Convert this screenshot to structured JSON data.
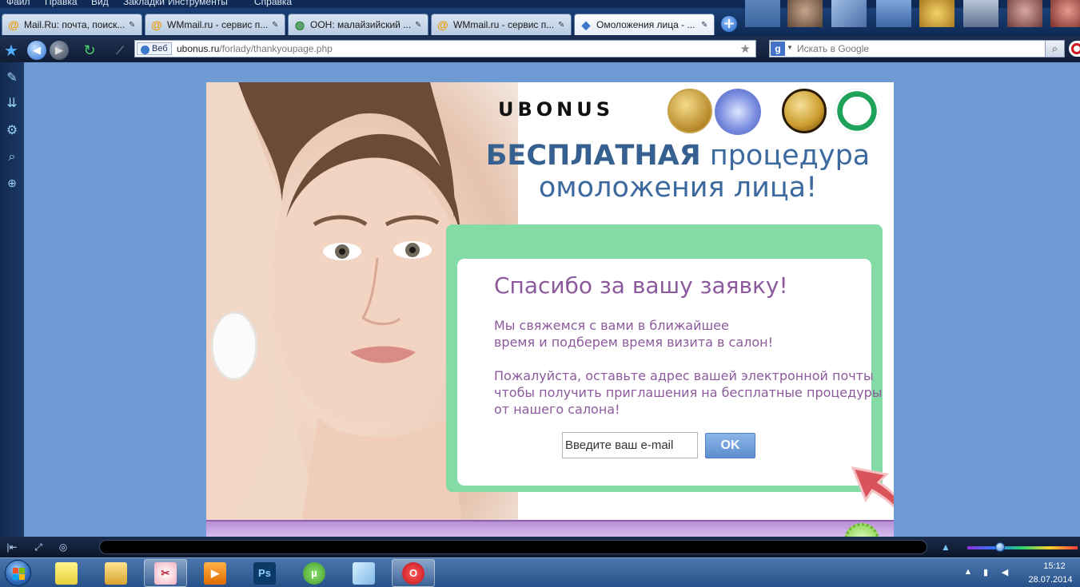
{
  "menu": [
    "Файл",
    "Правка",
    "Вид",
    "Закладки",
    "Инструменты",
    "Справка"
  ],
  "tabs": [
    {
      "label": "Mail.Ru: почта, поиск...",
      "icon": "mailru-icon"
    },
    {
      "label": "WMmail.ru - сервис п...",
      "icon": "at-sign-icon"
    },
    {
      "label": "ООН: малайзийский ...",
      "icon": "globe-icon"
    },
    {
      "label": "WMmail.ru - сервис п...",
      "icon": "at-sign-icon"
    },
    {
      "label": "Омоложения лица - ...",
      "icon": "page-icon"
    }
  ],
  "address": {
    "type_label": "Веб",
    "url_host": "ubonus.ru",
    "url_path": "/forlady/thankyoupage.php"
  },
  "search": {
    "engine": "g",
    "placeholder": "Искать в Google"
  },
  "page": {
    "brand": "Ubonus",
    "headline_strong": "БЕСПЛАТНАЯ",
    "headline_rest_1": "процедура",
    "headline_rest_2": "омоложения лица!",
    "thanks_title": "Спасибо за вашу заявку!",
    "message_lines": [
      "Мы свяжемся с вами в ближайшее",
      "время и подберем время визита в салон!",
      "Пожалуйста, оставьте адрес вашей электронной почты",
      "чтобы получить приглашения на бесплатные процедуры",
      "от нашего салона!"
    ],
    "email_placeholder": "Введите ваш e-mail",
    "ok_label": "OK",
    "badges": [
      "gold-award-badge",
      "quality-guarantee-badge",
      "100-percent-badge",
      "green-seal-badge"
    ]
  },
  "clock": {
    "time": "15:12",
    "date": "28.07.2014"
  },
  "colors": {
    "accent_blue": "#3c6a9e",
    "purple_text": "#8c5a9c",
    "green_frame": "#83dba6",
    "ok_button": "#6f9bd8"
  }
}
